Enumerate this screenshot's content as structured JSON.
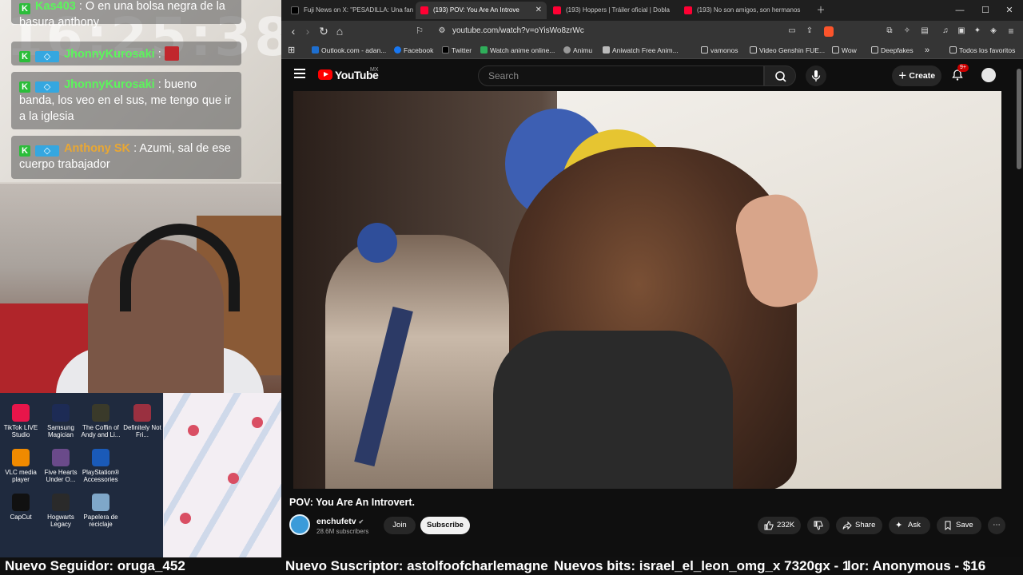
{
  "overlay": {
    "clock": "16:25:38",
    "chat": [
      {
        "user": "Kas403",
        "text": ": O en una bolsa negra de la basura anthony"
      },
      {
        "user": "JhonnyKurosaki",
        "text": ":"
      },
      {
        "user": "JhonnyKurosaki",
        "text": ": bueno banda, los veo en el sus, me tengo que ir a la iglesia"
      },
      {
        "user": "Anthony SK",
        "text": ": Azumi, sal de ese cuerpo trabajador"
      }
    ],
    "badge_k": "K"
  },
  "desktop": {
    "icons": [
      {
        "label": "TikTok LIVE Studio",
        "color": "#e8154a"
      },
      {
        "label": "Samsung Magician",
        "color": "#1d2b55"
      },
      {
        "label": "The Coffin of Andy and Li...",
        "color": "#3a3a2a"
      },
      {
        "label": "Definitely Not Fri...",
        "color": "#9a3040"
      },
      {
        "label": "VLC media player",
        "color": "#f08a00"
      },
      {
        "label": "Five Hearts Under O...",
        "color": "#6a4a8a"
      },
      {
        "label": "PlayStation® Accessories",
        "color": "#1a5ab8"
      },
      {
        "label": "CapCut",
        "color": "#111111"
      },
      {
        "label": "Hogwarts Legacy",
        "color": "#2a2a2a"
      },
      {
        "label": "Papelera de reciclaje",
        "color": "#7fa7c9"
      }
    ]
  },
  "ticker": {
    "follower": "Nuevo Seguidor: oruga_452",
    "subscriber": "Nuevo Suscriptor: astolfoofcharlemagne",
    "bits": "Nuevos bits: israel_el_leon_omg_x 7320gx - 1",
    "donor": "lor: Anonymous - $16"
  },
  "browser": {
    "tabs": [
      {
        "label": "Fuji News on X: \"PESADILLA: Una fan",
        "color": "#000000"
      },
      {
        "label": "(193) POV: You Are An Introve",
        "color": "#ff0033"
      },
      {
        "label": "(193) Hoppers | Tráiler oficial | Dobla",
        "color": "#ff0033"
      },
      {
        "label": "(193) No son amigos, son hermanos",
        "color": "#ff0033"
      }
    ],
    "url": "youtube.com/watch?v=oYisWo8zrWc",
    "bookmarks": [
      {
        "label": "Outlook.com - adan...",
        "color": "#1e6fd0"
      },
      {
        "label": "Facebook",
        "color": "#1877f2"
      },
      {
        "label": "Twitter",
        "color": "#000000"
      },
      {
        "label": "Watch anime online...",
        "color": "#2fae5a"
      },
      {
        "label": "Animu",
        "color": "#999999"
      },
      {
        "label": "Aniwatch Free Anim...",
        "color": "#bbbbbb"
      },
      {
        "label": "vamonos",
        "color": "#353535"
      },
      {
        "label": "Video Genshin FUE...",
        "color": "#353535"
      },
      {
        "label": "Wow",
        "color": "#353535"
      },
      {
        "label": "Deepfakes",
        "color": "#353535"
      }
    ],
    "bookmarks_more": "»",
    "all_favorites": "Todos los favoritos"
  },
  "youtube": {
    "brand": "YouTube",
    "region": "MX",
    "search_placeholder": "Search",
    "create": "Create",
    "notifications": "9+",
    "video_title": "POV: You Are An Introvert.",
    "channel": "enchufetv",
    "subscribers": "28.6M subscribers",
    "join": "Join",
    "subscribe": "Subscribe",
    "likes": "232K",
    "share": "Share",
    "ask": "Ask",
    "save": "Save"
  }
}
